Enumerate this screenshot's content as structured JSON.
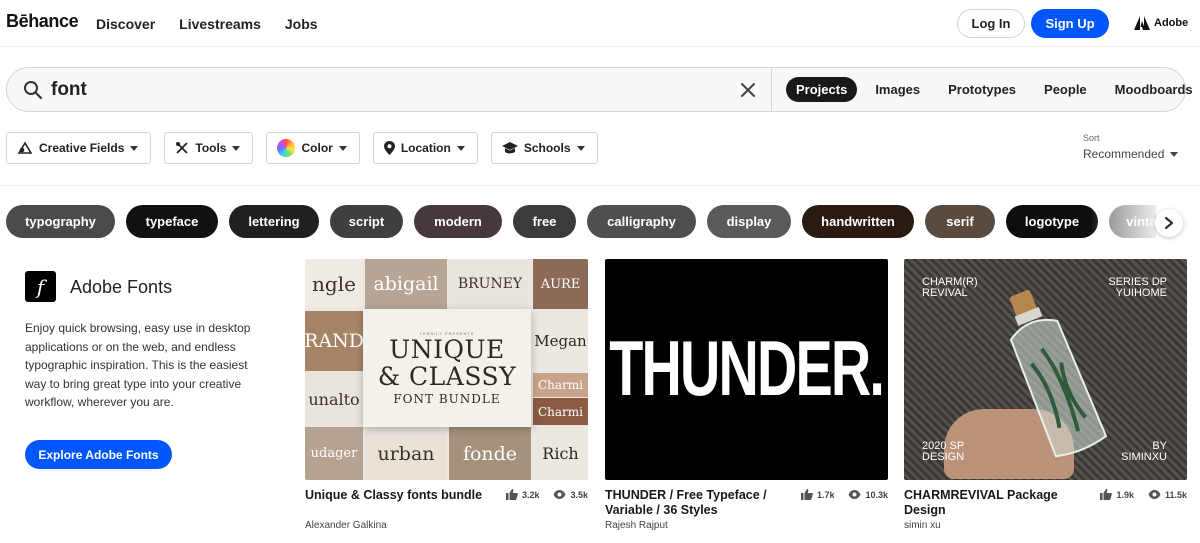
{
  "nav": {
    "logo": "Bēhance",
    "links": [
      "Discover",
      "Livestreams",
      "Jobs"
    ],
    "login": "Log In",
    "signup": "Sign Up",
    "adobe": "Adobe"
  },
  "search": {
    "value": "font",
    "tabs": [
      "Projects",
      "Images",
      "Prototypes",
      "People",
      "Moodboards"
    ],
    "active_tab": "Projects"
  },
  "filters": {
    "items": [
      "Creative Fields",
      "Tools",
      "Color",
      "Location",
      "Schools"
    ],
    "sort_label": "Sort",
    "sort_value": "Recommended"
  },
  "chips": [
    {
      "label": "typography",
      "color": "#4a4a4a"
    },
    {
      "label": "typeface",
      "color": "#111111"
    },
    {
      "label": "lettering",
      "color": "#202020"
    },
    {
      "label": "script",
      "color": "#3f3f3f"
    },
    {
      "label": "modern",
      "color": "#46383c"
    },
    {
      "label": "free",
      "color": "#3b3b3b"
    },
    {
      "label": "calligraphy",
      "color": "#4f4f4f"
    },
    {
      "label": "display",
      "color": "#5a5a5a"
    },
    {
      "label": "handwritten",
      "color": "#2a1a12"
    },
    {
      "label": "serif",
      "color": "#5b4a3e"
    },
    {
      "label": "logotype",
      "color": "#0d0d0d"
    },
    {
      "label": "vintage",
      "color": "#7a7a7a"
    }
  ],
  "adobe_fonts": {
    "logo_letter": "f",
    "title": "Adobe Fonts",
    "description": "Enjoy quick browsing, easy use in desktop applications or on the web, and endless typographic inspiration. This is the easiest way to bring great type into your creative workflow, wherever you are.",
    "button": "Explore Adobe Fonts"
  },
  "projects": [
    {
      "title": "Unique & Classy fonts bundle",
      "author": "Alexander Galkina",
      "likes": "3.2k",
      "views": "3.5k",
      "thumb": {
        "cells": [
          "ngle",
          "abigail",
          "BRUNEY",
          "AURE",
          "RAND",
          "Megan",
          "unalto",
          "Charmi",
          "Charmi",
          "udager",
          "urban",
          "fonde",
          "Rich"
        ],
        "center_small": "TENSILY PRESENTS",
        "center_big": [
          "UNIQUE",
          "& CLASSY"
        ],
        "center_sub": "FONT BUNDLE"
      }
    },
    {
      "title": "THUNDER / Free Typeface / Variable / 36 Styles",
      "author": "Rajesh Rajput",
      "likes": "1.7k",
      "views": "10.3k",
      "thumb": {
        "word": "THUNDER."
      }
    },
    {
      "title": "CHARMREVIVAL Package Design",
      "author": "simin xu",
      "likes": "1.9k",
      "views": "11.5k",
      "thumb": {
        "top_left": "CHARM(R)\nREVIVAL",
        "top_right": "SERIES DP\nYUIHOME",
        "bottom_left": "2020 SP\nDESIGN",
        "bottom_right": "BY\nSIMINXU"
      }
    }
  ],
  "colors": {
    "accent": "#0057ff",
    "active_tab": "#191919"
  }
}
